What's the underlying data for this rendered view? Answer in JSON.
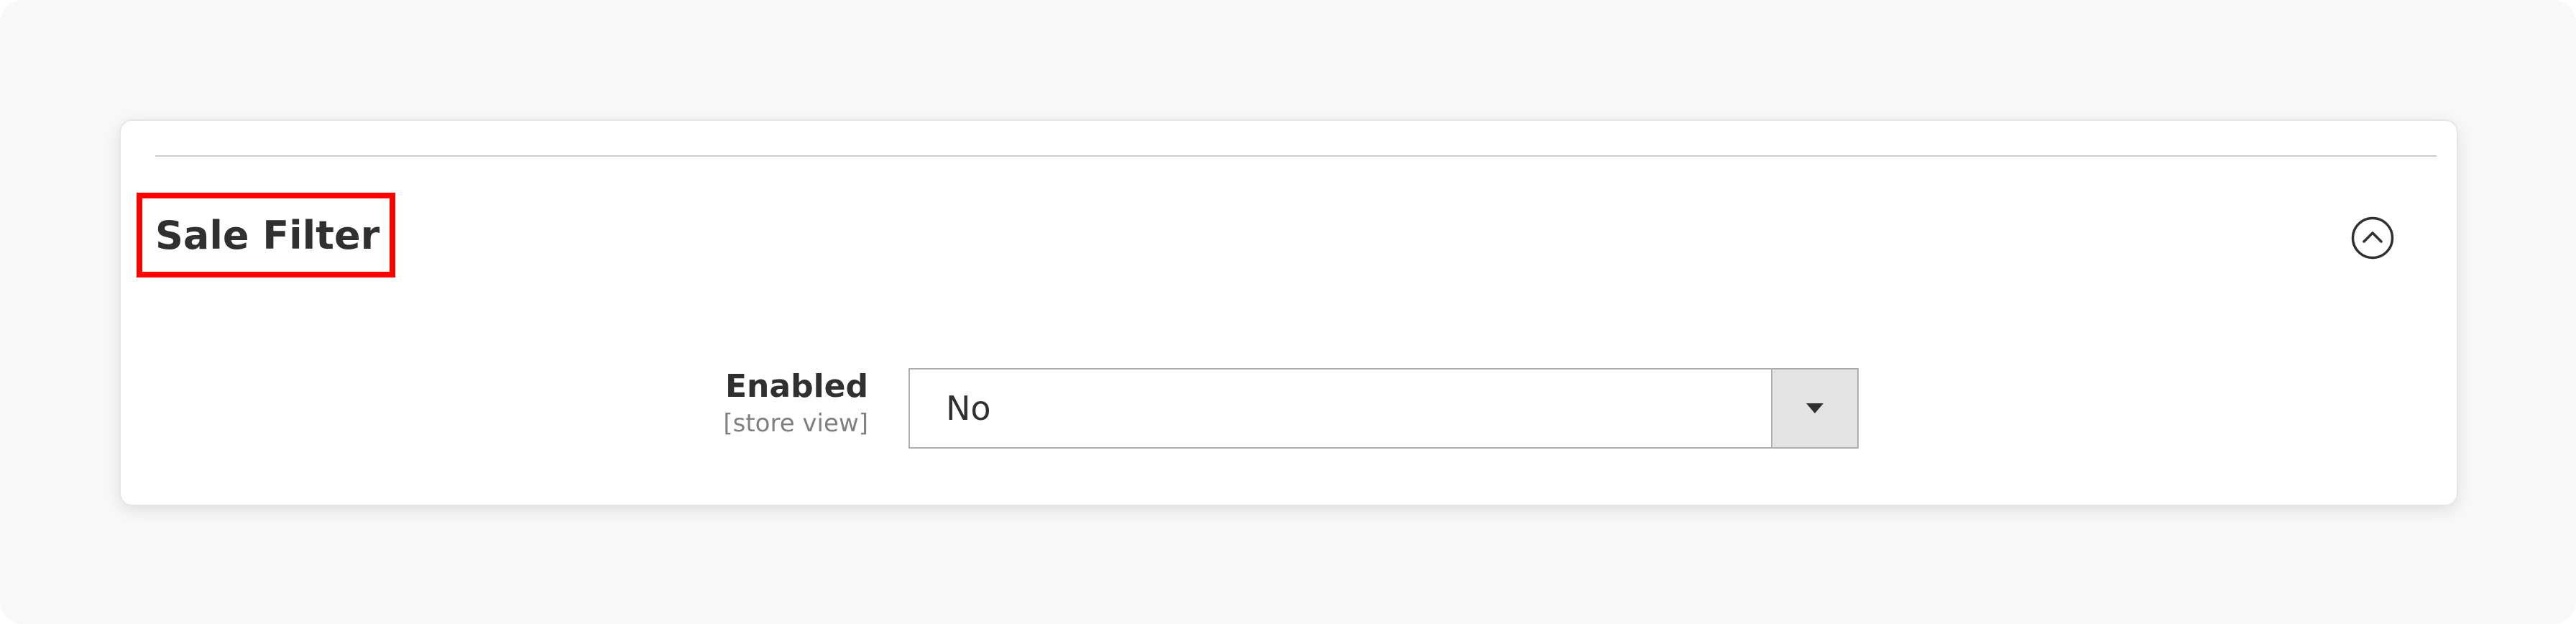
{
  "section": {
    "title": "Sale Filter",
    "collapse_icon": "chevron-up-circle-icon"
  },
  "fields": {
    "enabled": {
      "label": "Enabled",
      "scope": "[store view]",
      "value": "No",
      "arrow_icon": "caret-down-icon"
    }
  },
  "colors": {
    "highlight_border": "#ff0000",
    "text_primary": "#303030",
    "text_muted": "#808080",
    "select_arrow_bg": "#e3e3e3"
  }
}
